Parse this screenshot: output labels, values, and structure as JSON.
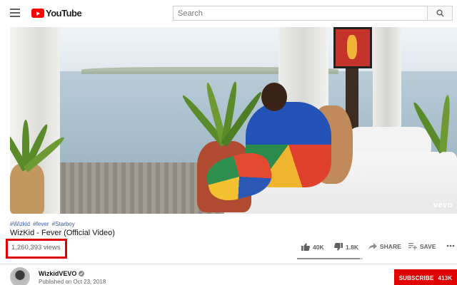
{
  "header": {
    "logo_text": "YouTube",
    "search_placeholder": "Search"
  },
  "video": {
    "watermark": "vevo"
  },
  "info": {
    "hashtags": [
      "#Wizkid",
      "#fever",
      "#Starboy"
    ],
    "title": "WizKid - Fever (Official Video)",
    "views": "1,260,393 views"
  },
  "actions": {
    "like_count": "40K",
    "dislike_count": "1.8K",
    "share_label": "SHARE",
    "save_label": "SAVE",
    "like_ratio": 0.957
  },
  "channel": {
    "name": "WizkidVEVO",
    "published": "Published on Oct 23, 2018",
    "subscribe_label": "SUBSCRIBE",
    "subscriber_count": "413K"
  },
  "colors": {
    "brand_red": "#ff0000",
    "highlight_box": "#e00000",
    "hashtag_blue": "#3b5ea6"
  }
}
